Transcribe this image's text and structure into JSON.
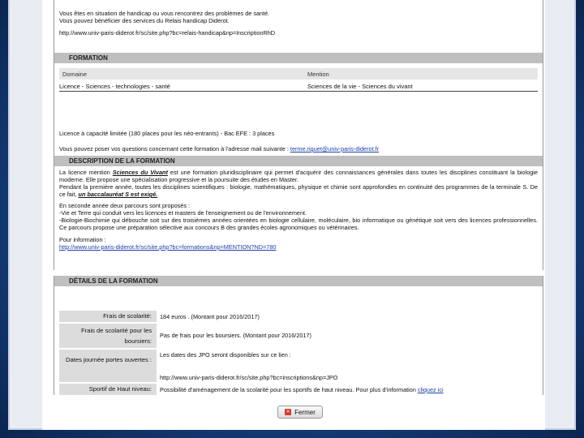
{
  "top": {
    "line1": "Vous êtes en situation de handicap ou vous rencontrez des problèmes de santé.",
    "line2": "Vous pouvez bénéficier des services du Relais handicap Diderot.",
    "link": "http://www.univ-paris-diderot.fr/sc/site.php?bc=relais-handicap&np=InscriptionRhD"
  },
  "formation": {
    "title": "FORMATION",
    "headers": {
      "domaine": "Domaine",
      "mention": "Mention"
    },
    "row": {
      "domaine": "Licence - Sciences - technologies - santé",
      "mention": "Sciences de la vie - Sciences du vivant"
    },
    "capacity": "Licence à capacité limitée (180 places pour les néo-entrants) - Bac EFE : 3 places",
    "contact_text": "Vous pouvez poser vos questions concernant cette formation à l'adresse mail suivante :",
    "contact_email": "terme.riguet@univ-paris-diderot.fr"
  },
  "description": {
    "title": "DESCRIPTION DE LA FORMATION",
    "p1_a": "La licence mention",
    "p1_em": "Sciences du Vivant",
    "p1_b": "est une formation pluridisciplinaire qui permet d'acquérir des connaissances générales dans toutes les disciplines constituant la biologie moderne. Elle propose une spécialisation progressive et la poursuite des études en Master.",
    "p2_a": "Pendant la première année, toutes les disciplines scientifiques : biologie, mathématiques, physique et chimie sont approfondies en continuité des programmes de la terminale S. De ce fait,",
    "p2_em": "un baccalauréat S est exigé.",
    "p3": "En seconde année deux parcours sont proposés :",
    "p4": "-Vie et Terre qui conduit vers les licences et masters de l'enseignement ou de l'environnement.",
    "p5": "-Biologie-Biochimie qui débouche soit sur des troisièmes années orientées en biologie cellulaire, moléculaire, bio informatique ou génétique soit vers des licences professionnelles. Ce parcours propose une préparation sélective aux concours B des grandes écoles agronomiques ou vétérinaires.",
    "info_label": "Pour information :",
    "info_link": "http://www.univ-paris-diderot.fr/sc/site.php?bc=formations&np=MENTION?ND=780"
  },
  "details": {
    "title": "DÉTAILS DE LA FORMATION",
    "frais_label": "Frais de scolarité:",
    "frais_value": "184 euros . (Montant pour 2016/2017)",
    "boursier_label": "Frais de scolarité pour les boursiers:",
    "boursier_value": "Pas de frais pour les boursiers. (Montant pour 2016/2017)",
    "jpo_label": "Dates journée portes ouvertes :",
    "jpo_value": "Les dates des JPO seront disponibles sur ce lien :",
    "jpo_link": "http://www.univ-paris-diderot.fr/sc/site.php?bc=inscriptions&np=JPO",
    "sport_label": "Sportif de Haut niveau:",
    "sport_value": "Possibilité d'aménagement de la scolarité pour les sportifs de haut niveau. Pour plus d'information",
    "sport_link": "cliquez ici"
  },
  "close_button": "Fermer"
}
